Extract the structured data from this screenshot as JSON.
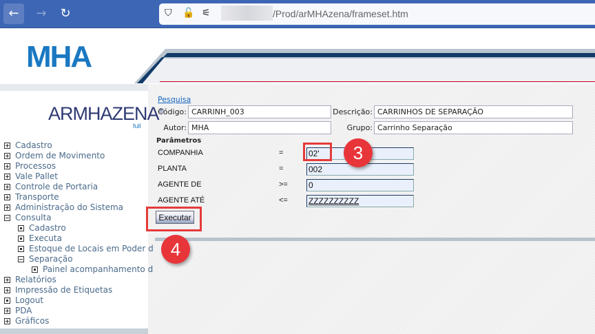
{
  "browser": {
    "url_path": "/Prod/arMHAzena/frameset.htm",
    "icons": [
      "back-arrow-icon",
      "forward-arrow-icon",
      "reload-icon",
      "shield-icon",
      "lock-slash-icon",
      "permissions-icon"
    ]
  },
  "header": {
    "logo": "MHA",
    "accent_line_color": "#d0021b"
  },
  "sidebar": {
    "logo": "ARMHAZENA",
    "logo_sub": "full",
    "items": [
      {
        "label": "Cadastro",
        "level": 0,
        "icon": "plus"
      },
      {
        "label": "Ordem de Movimento",
        "level": 0,
        "icon": "plus"
      },
      {
        "label": "Processos",
        "level": 0,
        "icon": "plus"
      },
      {
        "label": "Vale Pallet",
        "level": 0,
        "icon": "plus"
      },
      {
        "label": "Controle de Portaria",
        "level": 0,
        "icon": "plus"
      },
      {
        "label": "Transporte",
        "level": 0,
        "icon": "plus"
      },
      {
        "label": "Administração do Sistema",
        "level": 0,
        "icon": "plus"
      },
      {
        "label": "Consulta",
        "level": 0,
        "icon": "minus"
      },
      {
        "label": "Cadastro",
        "level": 1,
        "icon": "dot"
      },
      {
        "label": "Executa",
        "level": 1,
        "icon": "dot"
      },
      {
        "label": "Estoque de Locais em Poder d",
        "level": 1,
        "icon": "dot"
      },
      {
        "label": "Separação",
        "level": 1,
        "icon": "minus"
      },
      {
        "label": "Painel acompanhamento d",
        "level": 2,
        "icon": "dot"
      },
      {
        "label": "Relatórios",
        "level": 0,
        "icon": "plus"
      },
      {
        "label": "Impressão de Etiquetas",
        "level": 0,
        "icon": "plus"
      },
      {
        "label": "Logout",
        "level": 0,
        "icon": "dot"
      },
      {
        "label": "PDA",
        "level": 0,
        "icon": "plus"
      },
      {
        "label": "Gráficos",
        "level": 0,
        "icon": "plus"
      }
    ]
  },
  "form": {
    "link": "Pesquisa",
    "codigo_label": "Código:",
    "codigo": "CARRINH_003",
    "descricao_label": "Descrição:",
    "descricao": "CARRINHOS DE SEPARAÇÃO",
    "autor_label": "Autor:",
    "autor": "MHA",
    "grupo_label": "Grupo:",
    "grupo": "Carrinho Separação",
    "params_title": "Parâmetros",
    "params": [
      {
        "label": "COMPANHIA",
        "op": "=",
        "value": "02'"
      },
      {
        "label": "PLANTA",
        "op": "=",
        "value": "002"
      },
      {
        "label": "AGENTE DE",
        "op": ">=",
        "value": "0"
      },
      {
        "label": "AGENTE ATÉ",
        "op": "<=",
        "value": "ZZZZZZZZZZ"
      }
    ],
    "execute": "Executar"
  },
  "annotations": {
    "step3": "3",
    "step4": "4",
    "color": "#e8353a"
  }
}
